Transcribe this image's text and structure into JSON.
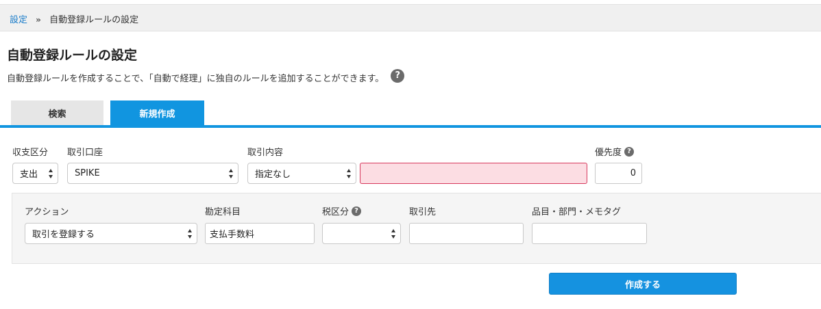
{
  "breadcrumb": {
    "root": "設定",
    "separator": "»",
    "current": "自動登録ルールの設定"
  },
  "page": {
    "title": "自動登録ルールの設定",
    "description": "自動登録ルールを作成することで、「自動で経理」に独自のルールを追加することができます。",
    "help_icon": "question-circle-icon"
  },
  "tabs": [
    {
      "label": "検索",
      "active": false
    },
    {
      "label": "新規作成",
      "active": true
    }
  ],
  "rule_form": {
    "direction": {
      "label": "収支区分",
      "value": "支出"
    },
    "account": {
      "label": "取引口座",
      "value": "SPIKE"
    },
    "content": {
      "label": "取引内容",
      "match_value": "指定なし",
      "text_value": ""
    },
    "priority": {
      "label": "優先度",
      "value": "0"
    }
  },
  "action_form": {
    "action": {
      "label": "アクション",
      "value": "取引を登録する"
    },
    "account_item": {
      "label": "勘定科目",
      "value": "支払手数料"
    },
    "tax": {
      "label": "税区分",
      "value": ""
    },
    "partner": {
      "label": "取引先",
      "value": ""
    },
    "tags": {
      "label": "品目・部門・メモタグ",
      "value": ""
    }
  },
  "submit_label": "作成する",
  "colors": {
    "accent": "#1195e0",
    "link": "#1a7cc9",
    "error_bg": "#fcdde3",
    "error_border": "#d6365b"
  }
}
